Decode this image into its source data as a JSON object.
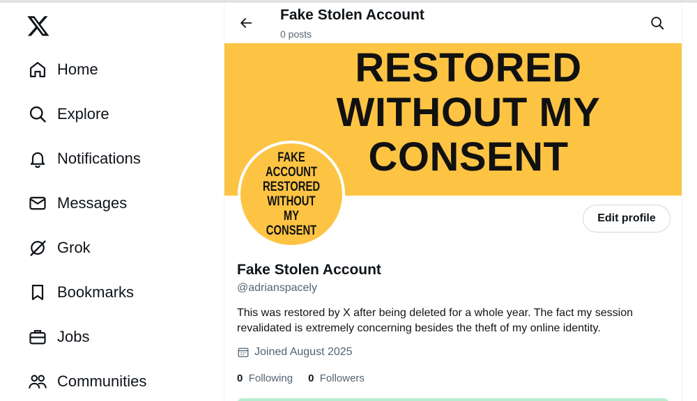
{
  "sidebar": {
    "logo": "x-logo-icon",
    "items": [
      {
        "label": "Home",
        "icon": "home-icon"
      },
      {
        "label": "Explore",
        "icon": "search-icon"
      },
      {
        "label": "Notifications",
        "icon": "bell-icon"
      },
      {
        "label": "Messages",
        "icon": "envelope-icon"
      },
      {
        "label": "Grok",
        "icon": "grok-icon"
      },
      {
        "label": "Bookmarks",
        "icon": "bookmark-icon"
      },
      {
        "label": "Jobs",
        "icon": "briefcase-icon"
      },
      {
        "label": "Communities",
        "icon": "people-icon"
      }
    ]
  },
  "header": {
    "title": "Fake Stolen Account",
    "subtitle": "0 posts"
  },
  "banner": {
    "text": "RESTORED WITHOUT MY CONSENT",
    "color": "#fdc444"
  },
  "avatar": {
    "text": "FAKE ACCOUNT\nRESTORED\nWITHOUT MY\nCONSENT"
  },
  "profile": {
    "edit_label": "Edit profile",
    "name": "Fake Stolen Account",
    "handle": "@adrianspacely",
    "bio": "This was restored by X after being deleted for a whole year. The fact my session revalidated is extremely concerning besides the theft of my online identity.",
    "joined": "Joined August 2025",
    "following_count": "0",
    "following_label": "Following",
    "followers_count": "0",
    "followers_label": "Followers"
  }
}
